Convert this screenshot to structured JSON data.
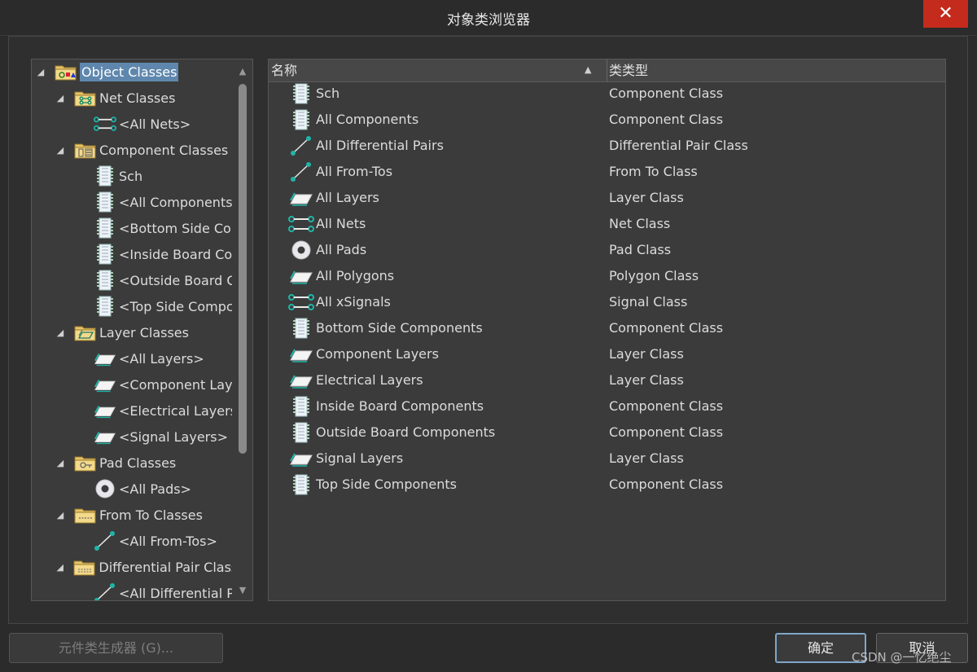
{
  "window": {
    "title": "对象类浏览器",
    "close_glyph": "✕"
  },
  "tree": {
    "root": {
      "label": "Object Classes",
      "icon": "object-classes-folder-icon"
    },
    "groups": [
      {
        "label": "Net Classes",
        "icon": "net-classes-folder-icon",
        "children": [
          {
            "label": "<All Nets>",
            "icon": "net-icon"
          }
        ]
      },
      {
        "label": "Component Classes",
        "icon": "component-classes-folder-icon",
        "children": [
          {
            "label": "Sch",
            "icon": "component-icon"
          },
          {
            "label": "<All Components",
            "icon": "component-icon"
          },
          {
            "label": "<Bottom Side Cor",
            "icon": "component-icon"
          },
          {
            "label": "<Inside Board Coi",
            "icon": "component-icon"
          },
          {
            "label": "<Outside Board C",
            "icon": "component-icon"
          },
          {
            "label": "<Top Side Compc",
            "icon": "component-icon"
          }
        ]
      },
      {
        "label": "Layer Classes",
        "icon": "layer-classes-folder-icon",
        "children": [
          {
            "label": "<All Layers>",
            "icon": "layer-icon"
          },
          {
            "label": "<Component Laye",
            "icon": "layer-icon"
          },
          {
            "label": "<Electrical Layers:",
            "icon": "layer-icon"
          },
          {
            "label": "<Signal Layers>",
            "icon": "layer-icon"
          }
        ]
      },
      {
        "label": "Pad Classes",
        "icon": "pad-classes-folder-icon",
        "children": [
          {
            "label": "<All Pads>",
            "icon": "pad-icon"
          }
        ]
      },
      {
        "label": "From To Classes",
        "icon": "fromto-classes-folder-icon",
        "children": [
          {
            "label": "<All From-Tos>",
            "icon": "fromto-icon"
          }
        ]
      },
      {
        "label": "Differential Pair Class",
        "icon": "diffpair-classes-folder-icon",
        "children": [
          {
            "label": "<All Differential Pa",
            "icon": "diffpair-icon"
          }
        ]
      }
    ],
    "scroll_up": "▲",
    "scroll_down": "▼",
    "expander": "◢"
  },
  "list": {
    "columns": {
      "name": "名称",
      "type": "类类型",
      "sort_glyph": "▲"
    },
    "rows": [
      {
        "name": "Sch",
        "type": "Component Class",
        "icon": "component-icon"
      },
      {
        "name": "All Components",
        "type": "Component Class",
        "icon": "component-icon"
      },
      {
        "name": "All Differential Pairs",
        "type": "Differential Pair Class",
        "icon": "diffpair-icon"
      },
      {
        "name": "All From-Tos",
        "type": "From To Class",
        "icon": "fromto-icon"
      },
      {
        "name": "All Layers",
        "type": "Layer Class",
        "icon": "layer-icon"
      },
      {
        "name": "All Nets",
        "type": "Net Class",
        "icon": "net-icon"
      },
      {
        "name": "All Pads",
        "type": "Pad Class",
        "icon": "pad-icon"
      },
      {
        "name": "All Polygons",
        "type": "Polygon Class",
        "icon": "layer-icon"
      },
      {
        "name": "All xSignals",
        "type": "Signal Class",
        "icon": "net-icon"
      },
      {
        "name": "Bottom Side Components",
        "type": "Component Class",
        "icon": "component-icon"
      },
      {
        "name": "Component Layers",
        "type": "Layer Class",
        "icon": "layer-icon"
      },
      {
        "name": "Electrical Layers",
        "type": "Layer Class",
        "icon": "layer-icon"
      },
      {
        "name": "Inside Board Components",
        "type": "Component Class",
        "icon": "component-icon"
      },
      {
        "name": "Outside Board Components",
        "type": "Component Class",
        "icon": "component-icon"
      },
      {
        "name": "Signal Layers",
        "type": "Layer Class",
        "icon": "layer-icon"
      },
      {
        "name": "Top Side Components",
        "type": "Component Class",
        "icon": "component-icon"
      }
    ]
  },
  "buttons": {
    "generator": "元件类生成器 (G)...",
    "ok": "确定",
    "cancel": "取消"
  },
  "watermark": "CSDN @一忆绝尘",
  "colors": {
    "accent": "#5f87ad",
    "close": "#c42b1c",
    "teal": "#1fb5a8"
  }
}
